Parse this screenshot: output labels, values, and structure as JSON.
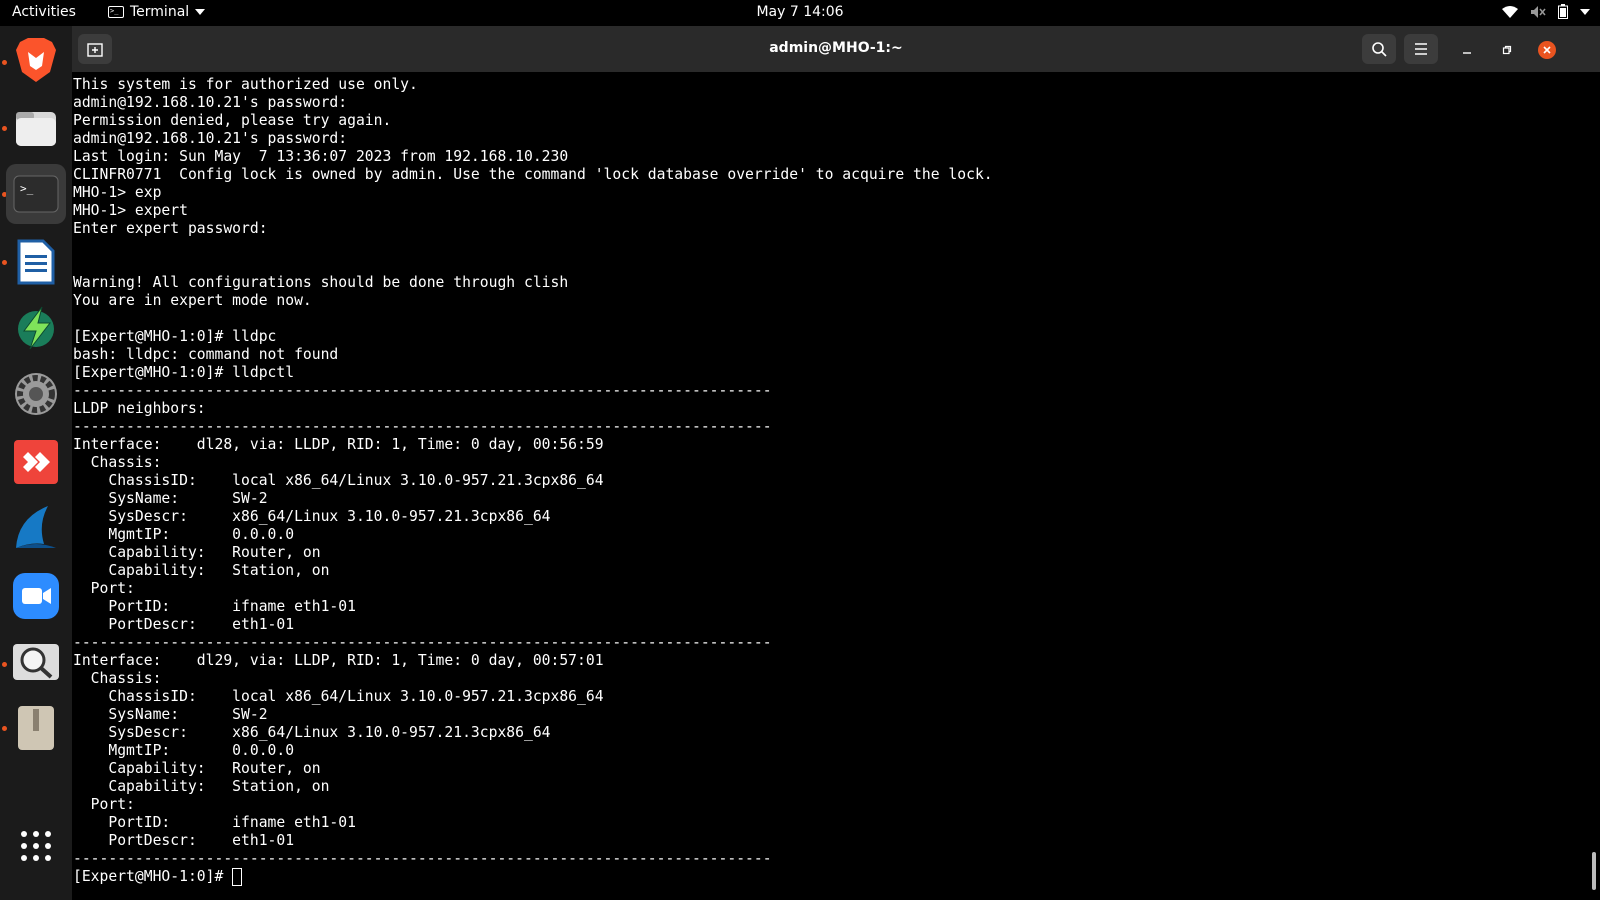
{
  "topbar": {
    "activities": "Activities",
    "app_name": "Terminal",
    "clock": "May 7  14:06"
  },
  "dock": {
    "items": [
      "brave-browser",
      "files",
      "terminal",
      "libreoffice-writer",
      "thunderbolt-app",
      "settings",
      "anydesk",
      "wireshark",
      "zoom",
      "magnifier",
      "archive-manager"
    ],
    "apps_grid": "show-applications"
  },
  "window": {
    "title": "admin@MHO-1:~"
  },
  "terminal": {
    "lines": [
      "This system is for authorized use only.",
      "admin@192.168.10.21's password:",
      "Permission denied, please try again.",
      "admin@192.168.10.21's password:",
      "Last login: Sun May  7 13:36:07 2023 from 192.168.10.230",
      "CLINFR0771  Config lock is owned by admin. Use the command 'lock database override' to acquire the lock.",
      "MHO-1> exp",
      "MHO-1> expert",
      "Enter expert password:",
      "",
      "",
      "Warning! All configurations should be done through clish",
      "You are in expert mode now.",
      "",
      "[Expert@MHO-1:0]# lldpc",
      "bash: lldpc: command not found",
      "[Expert@MHO-1:0]# lldpctl",
      "-------------------------------------------------------------------------------",
      "LLDP neighbors:",
      "-------------------------------------------------------------------------------",
      "Interface:    dl28, via: LLDP, RID: 1, Time: 0 day, 00:56:59",
      "  Chassis:",
      "    ChassisID:    local x86_64/Linux 3.10.0-957.21.3cpx86_64",
      "    SysName:      SW-2",
      "    SysDescr:     x86_64/Linux 3.10.0-957.21.3cpx86_64",
      "    MgmtIP:       0.0.0.0",
      "    Capability:   Router, on",
      "    Capability:   Station, on",
      "  Port:",
      "    PortID:       ifname eth1-01",
      "    PortDescr:    eth1-01",
      "-------------------------------------------------------------------------------",
      "Interface:    dl29, via: LLDP, RID: 1, Time: 0 day, 00:57:01",
      "  Chassis:",
      "    ChassisID:    local x86_64/Linux 3.10.0-957.21.3cpx86_64",
      "    SysName:      SW-2",
      "    SysDescr:     x86_64/Linux 3.10.0-957.21.3cpx86_64",
      "    MgmtIP:       0.0.0.0",
      "    Capability:   Router, on",
      "    Capability:   Station, on",
      "  Port:",
      "    PortID:       ifname eth1-01",
      "    PortDescr:    eth1-01",
      "-------------------------------------------------------------------------------"
    ],
    "prompt": "[Expert@MHO-1:0]# "
  }
}
